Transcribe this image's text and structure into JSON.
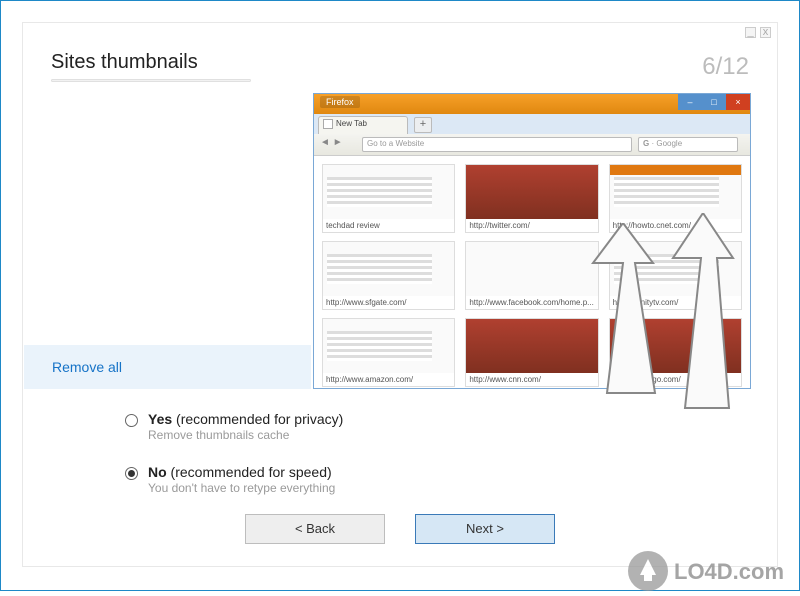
{
  "window": {
    "title": "Sites thumbnails",
    "step_current": 6,
    "step_total": 12,
    "step_label": "6/12"
  },
  "preview": {
    "browser_name": "Firefox",
    "tab_label": "New Tab",
    "tab_plus": "+",
    "nav_back": "◄",
    "nav_fwd": "►",
    "address_placeholder": "Go to a Website",
    "search_prefix": "G",
    "search_placeholder": "Google",
    "thumbnails": [
      {
        "caption": "techdad review"
      },
      {
        "caption": "http://twitter.com/"
      },
      {
        "caption": "http://howto.cnet.com/"
      },
      {
        "caption": "http://www.sfgate.com/"
      },
      {
        "caption": "http://www.facebook.com/home.p..."
      },
      {
        "caption": "http://xfinitytv.com/"
      },
      {
        "caption": "http://www.amazon.com/"
      },
      {
        "caption": "http://www.cnn.com/"
      },
      {
        "caption": "http://espn.go.com/"
      }
    ]
  },
  "actions": {
    "remove_all": "Remove all"
  },
  "options": {
    "yes": {
      "label_bold": "Yes",
      "label_rest": " (recommended for privacy)",
      "sub": "Remove thumbnails cache",
      "selected": false
    },
    "no": {
      "label_bold": "No",
      "label_rest": " (recommended for speed)",
      "sub": "You don't have to retype everything",
      "selected": true
    }
  },
  "buttons": {
    "back": "< Back",
    "next": "Next >"
  },
  "watermark": "LO4D.com"
}
